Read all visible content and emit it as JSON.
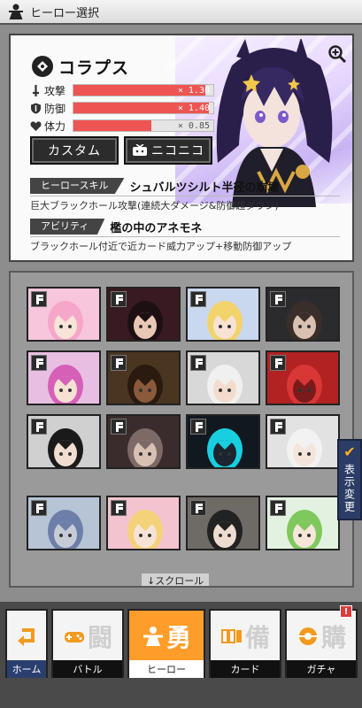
{
  "header": {
    "title": "ヒーロー選択"
  },
  "hero": {
    "name": "コラプス",
    "stats": [
      {
        "label": "攻撃",
        "multiplier": "× 1.30",
        "level": 0.94
      },
      {
        "label": "防御",
        "multiplier": "× 1.40",
        "level": 0.97
      },
      {
        "label": "体力",
        "multiplier": "× 0.85",
        "level": 0.56
      }
    ],
    "custom_button": "カスタム",
    "nico_button": "ニコニコ",
    "hero_skill_tag": "ヒーロースキル",
    "hero_skill_name": "シュバルツシルト半径の崩壊",
    "hero_skill_desc": "巨大ブラックホール攻撃(連続大ダメージ&防御超ダウン)",
    "ability_tag": "アビリティ",
    "ability_name": "檻の中のアネモネ",
    "ability_desc": "ブラックホール付近で近カード威力アップ+移動防御アップ"
  },
  "roster": {
    "scroll_label": "↓スクロール",
    "display_toggle": "表示変更",
    "cards": [
      {
        "bg": "#f7c6dc",
        "hair": "#f5a6c9",
        "skin": "#f8e3d8"
      },
      {
        "bg": "#3a1a22",
        "hair": "#1d1013",
        "skin": "#e9c7b4"
      },
      {
        "bg": "#c9d8ee",
        "hair": "#f2d36c",
        "skin": "#f7e2d3"
      },
      {
        "bg": "#2b2b2e",
        "hair": "#3a2e2a",
        "skin": "#d9c0b0"
      },
      {
        "bg": "#e8bfe2",
        "hair": "#d65fb8",
        "skin": "#f6e0d4"
      },
      {
        "bg": "#4a3520",
        "hair": "#2a1a10",
        "skin": "#8a5a3a"
      },
      {
        "bg": "#d8d8d8",
        "hair": "#f0f0f0",
        "skin": "#f3dccd"
      },
      {
        "bg": "#b22222",
        "hair": "#d93636",
        "skin": "#7a1a1a"
      },
      {
        "bg": "#d0d0d0",
        "hair": "#1a1a1a",
        "skin": "#f1ddd0"
      },
      {
        "bg": "#3a2c2c",
        "hair": "#7d6a66",
        "skin": "#d8c0b3"
      },
      {
        "bg": "#121820",
        "hair": "#18cfe0",
        "skin": "#1c2530"
      },
      {
        "bg": "#e2e2e2",
        "hair": "#f2f2f2",
        "skin": "#f4e4da"
      },
      {
        "bg": "#b6c4d6",
        "hair": "#6d7fa8",
        "skin": "#c7cbd6"
      },
      {
        "bg": "#f3c4d0",
        "hair": "#f4d27a",
        "skin": "#f7e3d6"
      },
      {
        "bg": "#6e6a66",
        "hair": "#222222",
        "skin": "#efdcd0"
      },
      {
        "bg": "#e3f2e0",
        "hair": "#7fc85d",
        "skin": "#f6e6da"
      }
    ]
  },
  "nav": {
    "items": [
      {
        "key": "home",
        "label": "ホーム",
        "big": ""
      },
      {
        "key": "battle",
        "label": "バトル",
        "big": "闘"
      },
      {
        "key": "hero",
        "label": "ヒーロー",
        "big": "勇"
      },
      {
        "key": "card",
        "label": "カード",
        "big": "備"
      },
      {
        "key": "gacha",
        "label": "ガチャ",
        "big": "購",
        "badge": "!"
      }
    ]
  },
  "colors": {
    "accent": "#ff9d2a",
    "stat_fill": "#ee5451",
    "dark": "#2c2c2c",
    "toggle": "#2b3d66"
  }
}
